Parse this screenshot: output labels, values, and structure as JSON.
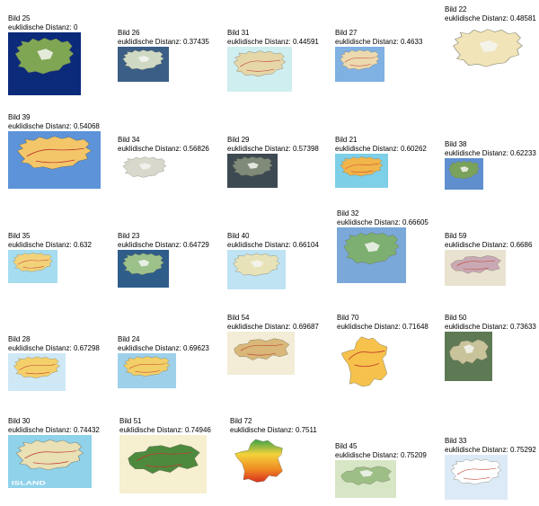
{
  "distance_label": "euklidische Distanz:",
  "results": [
    {
      "name": "Bild 25",
      "distance": "0",
      "map": "iceland",
      "bg": "#0b2a7a",
      "land": "#7fa653",
      "variant": "satellite"
    },
    {
      "name": "Bild 26",
      "distance": "0.37435",
      "map": "iceland",
      "bg": "#3b5e86",
      "land": "#cfd8c3",
      "variant": "relief"
    },
    {
      "name": "Bild 31",
      "distance": "0.44591",
      "map": "iceland",
      "bg": "#cfeef0",
      "land": "#e6d7a8",
      "variant": "road"
    },
    {
      "name": "Bild 27",
      "distance": "0.4633",
      "map": "iceland",
      "bg": "#7fb1e3",
      "land": "#ecd9b0",
      "variant": "road"
    },
    {
      "name": "Bild 22",
      "distance": "0.48581",
      "map": "iceland",
      "bg": "#ffffff",
      "land": "#f0e4b8",
      "variant": "relief"
    },
    {
      "name": "Bild 39",
      "distance": "0.54068",
      "map": "iceland",
      "bg": "#5d93d8",
      "land": "#f3c66a",
      "variant": "road"
    },
    {
      "name": "Bild 34",
      "distance": "0.56826",
      "map": "iceland",
      "bg": "#ffffff",
      "land": "#d8d8cc",
      "variant": "relief"
    },
    {
      "name": "Bild 29",
      "distance": "0.57398",
      "map": "iceland",
      "bg": "#3d4a52",
      "land": "#7f8a78",
      "variant": "satellite"
    },
    {
      "name": "Bild 21",
      "distance": "0.60262",
      "map": "iceland",
      "bg": "#7ecfe8",
      "land": "#f2b54a",
      "variant": "road"
    },
    {
      "name": "Bild 38",
      "distance": "0.62233",
      "map": "iceland",
      "bg": "#5f8fcf",
      "land": "#7aa25a",
      "variant": "relief"
    },
    {
      "name": "Bild 35",
      "distance": "0.632",
      "map": "iceland",
      "bg": "#a6dcef",
      "land": "#f3d37a",
      "variant": "road"
    },
    {
      "name": "Bild 23",
      "distance": "0.64729",
      "map": "iceland",
      "bg": "#2f5d8a",
      "land": "#9cc18a",
      "variant": "relief"
    },
    {
      "name": "Bild 40",
      "distance": "0.66104",
      "map": "iceland",
      "bg": "#bfe3f3",
      "land": "#e8e2b8",
      "variant": "relief"
    },
    {
      "name": "Bild 32",
      "distance": "0.66605",
      "map": "iceland",
      "bg": "#7aa8d8",
      "land": "#7db070",
      "variant": "relief"
    },
    {
      "name": "Bild 59",
      "distance": "0.6686",
      "map": "swiss",
      "bg": "#e9e2d0",
      "land": "#c9a9b3",
      "variant": "road"
    },
    {
      "name": "Bild 28",
      "distance": "0.67298",
      "map": "iceland",
      "bg": "#cfe8f6",
      "land": "#f4d06a",
      "variant": "road"
    },
    {
      "name": "Bild 24",
      "distance": "0.69623",
      "map": "iceland",
      "bg": "#9fd0ea",
      "land": "#f2cf67",
      "variant": "road"
    },
    {
      "name": "Bild 54",
      "distance": "0.69687",
      "map": "swiss",
      "bg": "#f3ecd6",
      "land": "#d8b779",
      "variant": "road"
    },
    {
      "name": "Bild 70",
      "distance": "0.71648",
      "map": "france",
      "bg": "#ffffff",
      "land": "#f6c24c",
      "variant": "road"
    },
    {
      "name": "Bild 50",
      "distance": "0.73633",
      "map": "swiss",
      "bg": "#5e7a55",
      "land": "#c8c39a",
      "variant": "relief"
    },
    {
      "name": "Bild 30",
      "distance": "0.74432",
      "map": "iceland",
      "bg": "#8fd2ea",
      "land": "#e9e0b6",
      "variant": "road",
      "caption": "ISLAND"
    },
    {
      "name": "Bild 51",
      "distance": "0.74946",
      "map": "swiss",
      "bg": "#f6efd0",
      "land": "#4d8a3d",
      "variant": "road"
    },
    {
      "name": "Bild 72",
      "distance": "0.7511",
      "map": "france",
      "bg": "#ffffff",
      "land": "#e2541f",
      "variant": "gradient"
    },
    {
      "name": "Bild 45",
      "distance": "0.75209",
      "map": "swiss",
      "bg": "#d7e6c5",
      "land": "#9dbf86",
      "variant": "relief"
    },
    {
      "name": "Bild 33",
      "distance": "0.75292",
      "map": "iceland",
      "bg": "#dceaf7",
      "land": "#ffffff",
      "variant": "road"
    }
  ]
}
